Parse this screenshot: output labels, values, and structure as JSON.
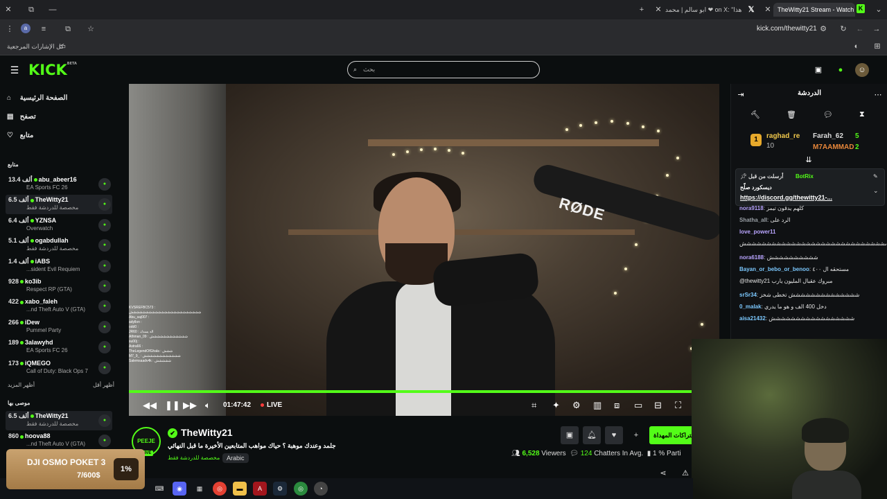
{
  "browser": {
    "tabs": [
      {
        "title": "TheWitty21 Stream - Watch"
      },
      {
        "title": "ابو سالم | محمد ❤ on X: \"هذا ..."
      },
      {
        "title": "X"
      }
    ],
    "url": "kick.com/thewitty21",
    "bookmarks_label": "كل الإشارات المرجعية"
  },
  "header": {
    "logo": "KICK",
    "logo_badge": "BETA",
    "search_placeholder": "بحث"
  },
  "sidebar": {
    "nav": [
      {
        "label": "الصفحة الرئيسية",
        "icon": "home-icon"
      },
      {
        "label": "تصفح",
        "icon": "browse-icon"
      },
      {
        "label": "متابع",
        "icon": "heart-icon"
      }
    ],
    "following_title": "متابع",
    "following": [
      {
        "count": "13.4 ألف",
        "name": "abu_abeer16",
        "category": "EA Sports FC 26"
      },
      {
        "count": "6.5 ألف",
        "name": "TheWitty21",
        "category": "مخصصة للدردشة فقط",
        "selected": true
      },
      {
        "count": "6.4 ألف",
        "name": "YZNSA",
        "category": "Overwatch"
      },
      {
        "count": "5.1 ألف",
        "name": "ogabdullah",
        "category": "مخصصة للدردشة فقط"
      },
      {
        "count": "1.4 ألف",
        "name": "iABS",
        "category": "...sident Evil Requiem"
      },
      {
        "count": "928",
        "name": "ko3ib",
        "category": "Respect RP (GTA)"
      },
      {
        "count": "422",
        "name": "xabo_faleh",
        "category": "...nd Theft Auto V (GTA)"
      },
      {
        "count": "266",
        "name": "iDew",
        "category": "Pummel Party"
      },
      {
        "count": "189",
        "name": "3alawyhd",
        "category": "EA Sports FC 26"
      },
      {
        "count": "173",
        "name": "iQMEGO",
        "category": "Call of Duty: Black Ops 7"
      }
    ],
    "show_more": "أظهر المزيد",
    "show_less": "أظهر أقل",
    "recommended_title": "موصى بها",
    "recommended": [
      {
        "count": "6.5 ألف",
        "name": "TheWitty21",
        "category": "مخصصة للدردشة فقط",
        "selected": true
      },
      {
        "count": "860",
        "name": "hoova88",
        "category": "...nd Theft Auto V (GTA)"
      }
    ]
  },
  "video": {
    "timecode": "01:47:42",
    "live_label": "LIVE",
    "brand_text": "RØDE",
    "overlay_lines": [
      "KVSREFBC573 :",
      "ششششششششششششششششششششششش",
      "Abu_saj007 :",
      "adyllon :",
      "odd0 :",
      "JR60 : اله يسدك",
      "Athman_09 : شششششششششششش",
      "su00j :",
      "Astra66 :",
      "TheLegendOfGhala : ششش",
      "M7_9_ : شششششششششششش",
      "Salemsaadv4k : ششششش"
    ]
  },
  "stream": {
    "channel_name": "TheWitty21",
    "avatar_text": "PEEJE",
    "live_badge": "LIVE",
    "title": "جلمد وعندك موهبة ؟ حياك مواهب المتابعين الأخيرة ما قبل النهائي",
    "category": "مخصصة للدردشة فقط",
    "language": "Arabic",
    "subscribe_label": "اشتراكات المهداة",
    "viewers": "6,528",
    "viewers_label": "Viewers",
    "chatters": "124",
    "chatters_label": "Chatters In Avg.",
    "participation": "1 %",
    "participation_label": "Parti"
  },
  "chat": {
    "title": "الدردشة",
    "leaderboard": [
      {
        "rank": "1",
        "name": "raghad_re",
        "value": "10"
      },
      {
        "name": "Farah_62",
        "value": "5"
      },
      {
        "name": "M7AAMMAD",
        "value": "2"
      }
    ],
    "pinned": {
      "pinned_by": "أرسلت من قبل",
      "author": "BotRix",
      "text": "ديسكورد صلّح",
      "link": "https://discord.gg/thewitty21-..."
    },
    "messages": [
      {
        "user": "nora9118",
        "text": "كلهم يدقون تيمز",
        "color": "#b9a5ff"
      },
      {
        "user": "Shatha_all",
        "text": "الرد على",
        "color": "#9aa0a6",
        "reply": true
      },
      {
        "user": "love_power11",
        "text": "",
        "color": "#b9a5ff"
      },
      {
        "user": "",
        "text": "ششششششششششششششششششششششششششششششششششششش",
        "color": "#e6e6e6"
      },
      {
        "user": "nora6188",
        "text": "شششششششششش",
        "color": "#b9a5ff"
      },
      {
        "user": "Bayan_or_bebo_or_benoo",
        "text": "مستحقه ال ٤٠٠",
        "color": "#7cc9ff"
      },
      {
        "user": "",
        "text": "@thewitty21 مبروك عقبال المليون يارب",
        "color": "#e6e6e6"
      },
      {
        "user": "srSr34",
        "text": "شششششششششششششش تخطى شخز",
        "color": "#7cc9ff"
      },
      {
        "user": "0_malak",
        "text": "دخل 400 الف و هو ما يدري",
        "color": "#7cc9ff"
      },
      {
        "user": "aisa21432",
        "text": "ششششششششششششششششش",
        "color": "#7cc9ff"
      }
    ]
  },
  "promo": {
    "title": "DJI OSMO POKET 3",
    "amount": "7/600$",
    "percent": "1%"
  },
  "colors": {
    "accent": "#53fc18",
    "background": "#0b0e0f",
    "chat_bg": "#0f1113"
  }
}
